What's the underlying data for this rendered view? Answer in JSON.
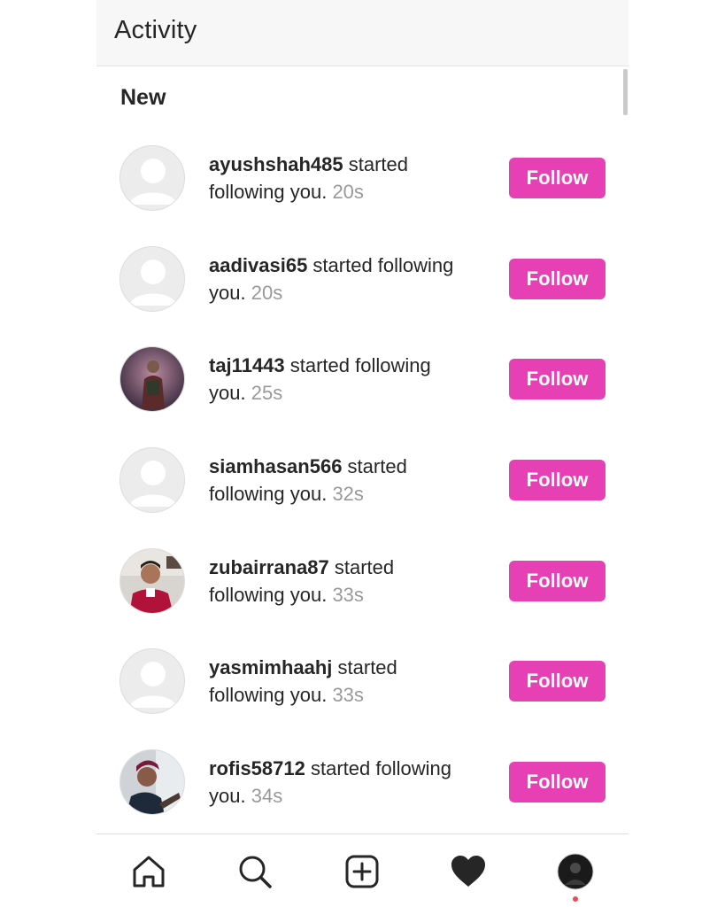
{
  "header": {
    "title": "Activity"
  },
  "section": {
    "title": "New"
  },
  "notifications": [
    {
      "username": "ayushshah485",
      "line1_rest": " started",
      "line2": "following you.",
      "time": "20s",
      "avatar": "default-avatar-icon",
      "button": "Follow"
    },
    {
      "username": "aadivasi65",
      "line1_rest": " started following",
      "line2": "you.",
      "time": "20s",
      "avatar": "default-avatar-icon",
      "button": "Follow"
    },
    {
      "username": "taj11443",
      "line1_rest": " started following",
      "line2": "you.",
      "time": "25s",
      "avatar": "photo-avatar",
      "button": "Follow"
    },
    {
      "username": "siamhasan566",
      "line1_rest": " started",
      "line2": "following you.",
      "time": "32s",
      "avatar": "default-avatar-icon",
      "button": "Follow"
    },
    {
      "username": "zubairrana87",
      "line1_rest": " started",
      "line2": "following you.",
      "time": "33s",
      "avatar": "photo-avatar",
      "button": "Follow"
    },
    {
      "username": "yasmimhaahj",
      "line1_rest": " started",
      "line2": "following you.",
      "time": "33s",
      "avatar": "default-avatar-icon",
      "button": "Follow"
    },
    {
      "username": "rofis58712",
      "line1_rest": " started following",
      "line2": "you.",
      "time": "34s",
      "avatar": "photo-avatar",
      "button": "Follow"
    }
  ],
  "nav": {
    "items": [
      "home-icon",
      "search-icon",
      "add-post-icon",
      "heart-icon",
      "profile-avatar"
    ]
  },
  "colors": {
    "follow_button": "#e640b4",
    "timestamp": "#999999",
    "notification_dot": "#ed4956"
  }
}
